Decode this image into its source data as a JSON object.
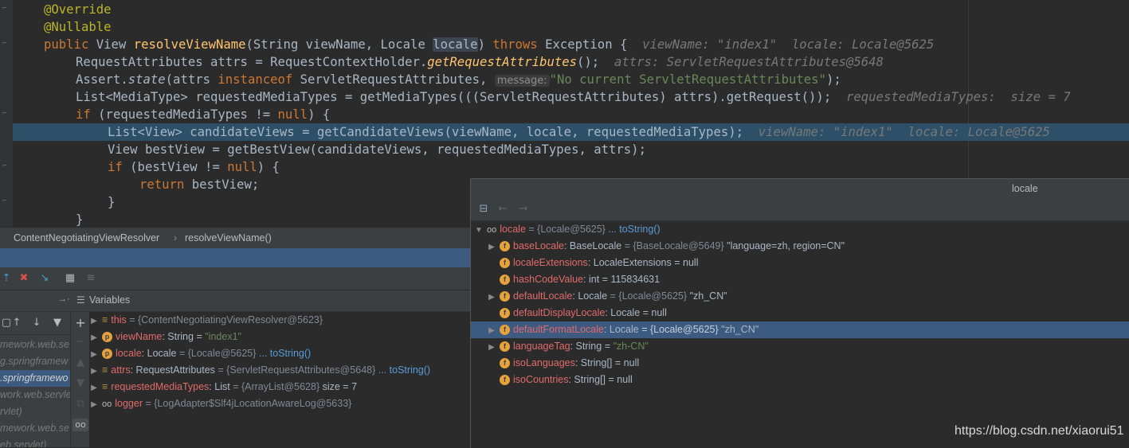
{
  "editor": {
    "lines": {
      "l1": "@Override",
      "l2": "@Nullable",
      "l3a": "public",
      "l3b": " View ",
      "l3c": "resolveViewName",
      "l3d": "(String viewName, Locale ",
      "l3e": "locale",
      "l3f": ") ",
      "l3g": "throws",
      "l3h": " Exception {  ",
      "l3hint": "viewName: \"index1\"  locale: Locale@5625",
      "l4a": "RequestAttributes attrs = RequestContextHolder.",
      "l4b": "getRequestAttributes",
      "l4c": "();  ",
      "l4hint": "attrs: ServletRequestAttributes@5648",
      "l5a": "Assert.",
      "l5b": "state",
      "l5c": "(attrs ",
      "l5d": "instanceof",
      "l5e": " ServletRequestAttributes, ",
      "l5badge": "message:",
      "l5f": "\"No current ServletRequestAttributes\"",
      "l5g": ");",
      "l6a": "List<MediaType> requestedMediaTypes = getMediaTypes(((ServletRequestAttributes) attrs).getRequest());  ",
      "l6hint": "requestedMediaTypes:  size = 7",
      "l7a": "if",
      "l7b": " (requestedMediaTypes != ",
      "l7c": "null",
      "l7d": ") {",
      "l8a": "List<View> candidateViews = getCandidateViews(viewName, locale, requestedMediaTypes);  ",
      "l8hint": "viewName: \"index1\"  locale: Locale@5625",
      "l9a": "View bestView = getBestView(candidateViews, requestedMediaTypes, attrs);",
      "l10a": "if",
      "l10b": " (bestView != ",
      "l10c": "null",
      "l10d": ") {",
      "l11a": "return",
      "l11b": " bestView;",
      "l12": "}",
      "l13": "}"
    }
  },
  "breadcrumb": {
    "class": "ContentNegotiatingViewResolver",
    "sep": "›",
    "method": "resolveViewName()"
  },
  "variables_panel": {
    "title": "Variables",
    "frames": [
      "mework.web.se",
      "g.springframew",
      ".springframewo",
      "work.web.servle",
      "rvlet)",
      "mework.web.se",
      "eb.servlet)"
    ],
    "rows": {
      "this_name": "this",
      "this_val": "= {ContentNegotiatingViewResolver@5623}",
      "vn_name": "viewName",
      "vn_type": ": String",
      "vn_eq": "=",
      "vn_val": "\"index1\"",
      "loc_name": "locale",
      "loc_type": ": Locale",
      "loc_val": "= {Locale@5625}",
      "loc_link": "... toString()",
      "attrs_name": "attrs",
      "attrs_type": ": RequestAttributes",
      "attrs_val": "= {ServletRequestAttributes@5648}",
      "attrs_link": "... toString()",
      "rmt_name": "requestedMediaTypes",
      "rmt_type": ": List",
      "rmt_val": "= {ArrayList@5628}",
      "rmt_size": "size = 7",
      "log_name": "logger",
      "log_val": "= {LogAdapter$Slf4jLocationAwareLog@5633}"
    }
  },
  "popup": {
    "title": "locale",
    "root_name": "locale",
    "root_val": "= {Locale@5625}",
    "root_link": "... toString()",
    "fields": {
      "f1_name": "baseLocale",
      "f1_type": ": BaseLocale",
      "f1_val": "= {BaseLocale@5649}",
      "f1_str": "\"language=zh, region=CN\"",
      "f2_name": "localeExtensions",
      "f2_type": ": LocaleExtensions",
      "f2_val": "= null",
      "f3_name": "hashCodeValue",
      "f3_type": ": int",
      "f3_val": "= 115834631",
      "f4_name": "defaultLocale",
      "f4_type": ": Locale",
      "f4_val": "= {Locale@5625}",
      "f4_str": "\"zh_CN\"",
      "f5_name": "defaultDisplayLocale",
      "f5_type": ": Locale",
      "f5_val": "= null",
      "f6_name": "defaultFormatLocale",
      "f6_type": ": Locale",
      "f6_val": "= {Locale@5625}",
      "f6_str": "\"zh_CN\"",
      "f7_name": "languageTag",
      "f7_type": ": String",
      "f7_val": "=",
      "f7_str": "\"zh-CN\"",
      "f8_name": "isoLanguages",
      "f8_type": ": String[]",
      "f8_val": "= null",
      "f9_name": "isoCountries",
      "f9_type": ": String[]",
      "f9_val": "= null"
    }
  },
  "watermark": "https://blog.csdn.net/xiaorui51",
  "icons": {
    "expand": "▶",
    "collapse": "▼",
    "field": "f",
    "param": "p",
    "watch": "oo",
    "add": "+",
    "up": "↑",
    "down": "↓",
    "filter": "▼",
    "back": "←",
    "forward": "→"
  },
  "colors": {
    "editor_bg": "#2b2b2b",
    "highlight": "#2d4f67",
    "selection": "#3d5a80",
    "keyword": "#cc7832",
    "string": "#6a8759",
    "field_icon": "#e6a23c"
  }
}
